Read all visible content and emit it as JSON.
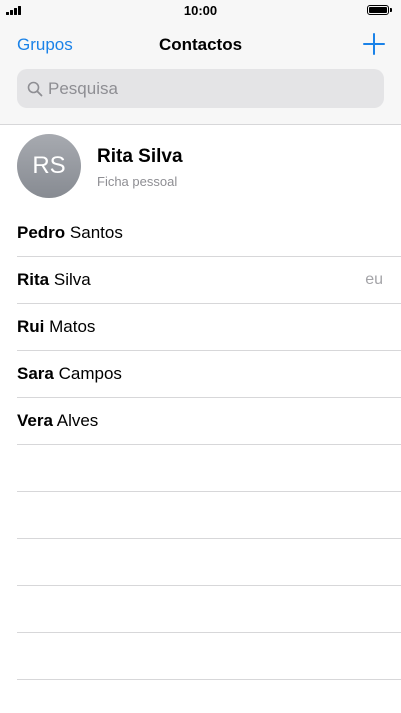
{
  "status_bar": {
    "time": "10:00"
  },
  "nav": {
    "left_label": "Grupos",
    "title": "Contactos",
    "add_icon": "plus-icon",
    "accent_color": "#1a82e8"
  },
  "search": {
    "placeholder": "Pesquisa",
    "icon": "search-icon"
  },
  "my_card": {
    "initials": "RS",
    "name": "Rita Silva",
    "subtitle": "Ficha pessoal"
  },
  "contacts": [
    {
      "first": "Pedro",
      "last": "Santos",
      "tag": ""
    },
    {
      "first": "Rita",
      "last": "Silva",
      "tag": "eu"
    },
    {
      "first": "Rui",
      "last": "Matos",
      "tag": ""
    },
    {
      "first": "Sara",
      "last": "Campos",
      "tag": ""
    },
    {
      "first": "Vera",
      "last": "Alves",
      "tag": ""
    }
  ]
}
